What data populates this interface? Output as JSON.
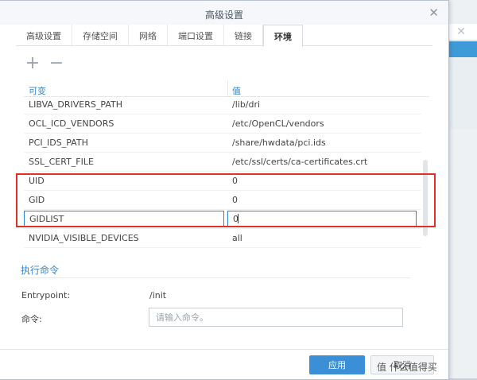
{
  "window": {
    "title": "高级设置"
  },
  "tabs": [
    {
      "label": "高级设置"
    },
    {
      "label": "存储空间"
    },
    {
      "label": "网络"
    },
    {
      "label": "端口设置"
    },
    {
      "label": "链接"
    },
    {
      "label": "环境",
      "active": true
    }
  ],
  "toolbar": {
    "add_icon": "plus-icon",
    "remove_icon": "minus-icon"
  },
  "env_table": {
    "headers": {
      "key": "可变",
      "value": "值"
    },
    "rows": [
      {
        "key": "LIBVA_DRIVERS_PATH",
        "value": "/lib/dri"
      },
      {
        "key": "OCL_ICD_VENDORS",
        "value": "/etc/OpenCL/vendors"
      },
      {
        "key": "PCI_IDS_PATH",
        "value": "/share/hwdata/pci.ids"
      },
      {
        "key": "SSL_CERT_FILE",
        "value": "/etc/ssl/certs/ca-certificates.crt"
      },
      {
        "key": "UID",
        "value": "0"
      },
      {
        "key": "GID",
        "value": "0"
      },
      {
        "key": "GIDLIST",
        "value": "0",
        "editing": true
      },
      {
        "key": "NVIDIA_VISIBLE_DEVICES",
        "value": "all"
      }
    ],
    "highlight_color": "#e03129"
  },
  "command_section": {
    "title": "执行命令",
    "entrypoint_label": "Entrypoint:",
    "entrypoint_value": "/init",
    "command_label": "命令:",
    "command_placeholder": "请输入命令。"
  },
  "footer": {
    "apply_label": "应用",
    "cancel_label": "取消"
  },
  "watermark": "值 什么值得买",
  "colors": {
    "accent": "#3a8fd6",
    "link": "#3b86c7"
  }
}
